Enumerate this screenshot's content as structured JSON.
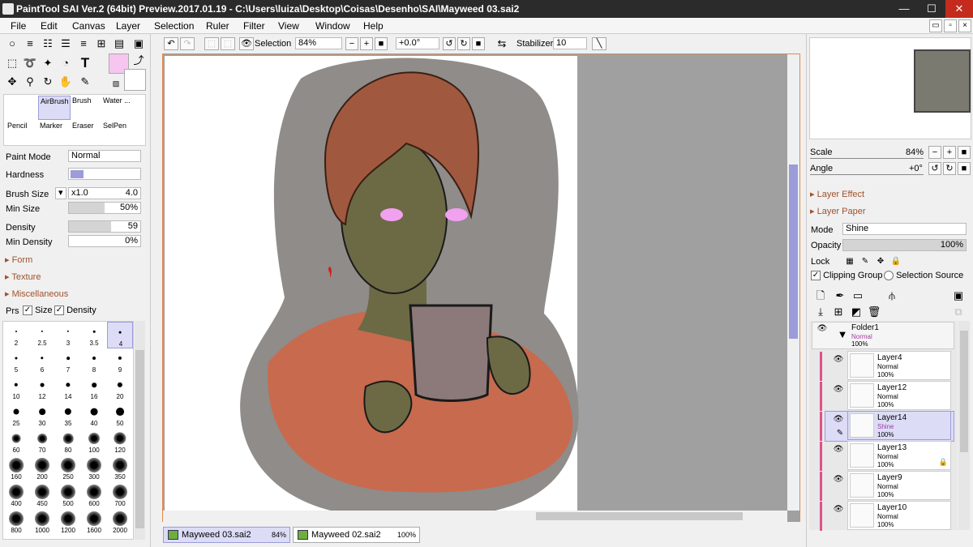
{
  "window": {
    "title": "PaintTool SAI Ver.2 (64bit) Preview.2017.01.19 - C:\\Users\\luiza\\Desktop\\Coisas\\Desenho\\SAI\\Mayweed 03.sai2",
    "minimize": "—",
    "maximize": "☐",
    "close": "✕"
  },
  "menu": [
    "File",
    "Edit",
    "Canvas",
    "Layer",
    "Selection",
    "Ruler",
    "Filter",
    "View",
    "Window",
    "Help"
  ],
  "toolbar": {
    "selection_label": "Selection",
    "zoom": "84%",
    "angle": "+0.0°",
    "stabilizer_label": "Stabilizer",
    "stabilizer": "10"
  },
  "tools": {
    "cells": [
      [
        "AirBrush",
        "Brush",
        "Water ..."
      ],
      [
        "Pencil",
        "Marker",
        "Eraser",
        "SelPen"
      ]
    ]
  },
  "brush": {
    "paint_mode_label": "Paint Mode",
    "paint_mode": "Normal",
    "hardness_label": "Hardness",
    "brush_size_label": "Brush Size",
    "brush_size_mult": "x1.0",
    "brush_size": "4.0",
    "min_size_label": "Min Size",
    "min_size": "50%",
    "density_label": "Density",
    "density": "59",
    "min_density_label": "Min Density",
    "min_density": "0%",
    "sections": [
      "Form",
      "Texture",
      "Miscellaneous"
    ],
    "prs_label": "Prs",
    "size_label": "Size",
    "density_chk_label": "Density"
  },
  "brush_sizes": [
    "2",
    "2.5",
    "3",
    "3.5",
    "4",
    "5",
    "6",
    "7",
    "8",
    "9",
    "10",
    "12",
    "14",
    "16",
    "20",
    "25",
    "30",
    "35",
    "40",
    "50",
    "60",
    "70",
    "80",
    "100",
    "120",
    "160",
    "200",
    "250",
    "300",
    "350",
    "400",
    "450",
    "500",
    "600",
    "700",
    "800",
    "1000",
    "1200",
    "1600",
    "2000"
  ],
  "right": {
    "scale_label": "Scale",
    "scale": "84%",
    "angle_label": "Angle",
    "angle": "+0°",
    "layer_effect": "Layer Effect",
    "layer_paper": "Layer Paper",
    "mode_label": "Mode",
    "mode": "Shine",
    "opacity_label": "Opacity",
    "opacity": "100%",
    "lock_label": "Lock",
    "clipping_label": "Clipping Group",
    "selection_source_label": "Selection Source"
  },
  "layers": [
    {
      "name": "Folder1",
      "mode": "Normal",
      "opacity": "100%"
    },
    {
      "name": "Layer4",
      "mode": "Normal",
      "opacity": "100%"
    },
    {
      "name": "Layer12",
      "mode": "Normal",
      "opacity": "100%"
    },
    {
      "name": "Layer14",
      "mode": "Shine",
      "opacity": "100%"
    },
    {
      "name": "Layer13",
      "mode": "Normal",
      "opacity": "100%"
    },
    {
      "name": "Layer9",
      "mode": "Normal",
      "opacity": "100%"
    },
    {
      "name": "Layer10",
      "mode": "Normal",
      "opacity": "100%"
    }
  ],
  "tabs": [
    {
      "name": "Mayweed 03.sai2",
      "zoom": "84%"
    },
    {
      "name": "Mayweed 02.sai2",
      "zoom": "100%"
    }
  ],
  "colors": {
    "primary": "#f7c6f0",
    "accent": "#e08a4a",
    "layer_clip": "#e0508a",
    "selected": "#dcdcf7"
  }
}
